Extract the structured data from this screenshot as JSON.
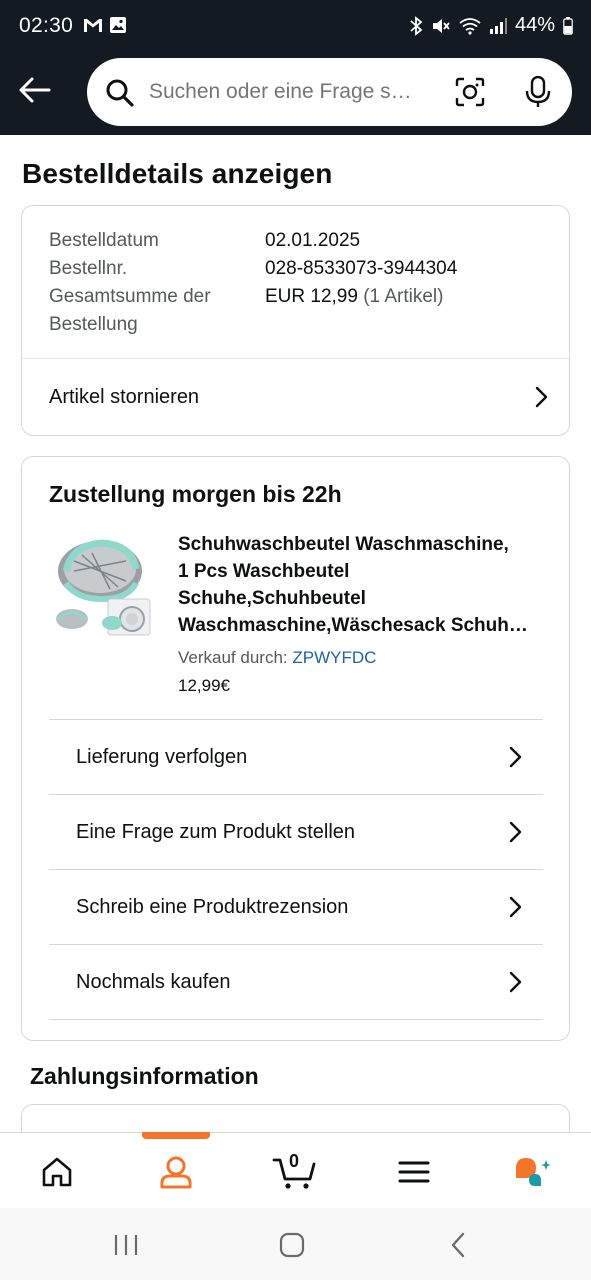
{
  "status_bar": {
    "time": "02:30",
    "battery": "44%"
  },
  "search": {
    "placeholder": "Suchen oder eine Frage s…"
  },
  "page_title": "Bestelldetails anzeigen",
  "order_summary": {
    "rows": [
      {
        "label": "Bestelldatum",
        "value": "02.01.2025"
      },
      {
        "label": "Bestellnr.",
        "value": "028-8533073-3944304"
      },
      {
        "label": "Gesamtsumme der",
        "label2": "Bestellung",
        "value": "EUR 12,99",
        "value_extra": "(1 Artikel)"
      }
    ],
    "cancel_link": "Artikel stornieren"
  },
  "delivery": {
    "title": "Zustellung morgen bis 22h",
    "product": {
      "title_lines": [
        "Schuhwaschbeutel Waschmaschine,",
        "1 Pcs Waschbeutel",
        "Schuhe,Schuhbeutel",
        "Waschmaschine,Wäschesack Schuh…"
      ],
      "seller_label": "Verkauf durch:",
      "seller_name": "ZPWYFDC",
      "price": "12,99€"
    },
    "actions": [
      "Lieferung verfolgen",
      "Eine Frage zum Produkt stellen",
      "Schreib eine Produktrezension",
      "Nochmals kaufen"
    ]
  },
  "payment": {
    "title": "Zahlungsinformation"
  },
  "bottom_nav": {
    "items": [
      "home-icon",
      "account-icon",
      "cart-icon",
      "menu-icon",
      "rufus-icon"
    ],
    "cart_count": "0",
    "active": "account-icon",
    "accent_color": "#f3752a"
  },
  "colors": {
    "header_bg": "#131a22",
    "link": "#2162a1",
    "muted": "#565959"
  }
}
